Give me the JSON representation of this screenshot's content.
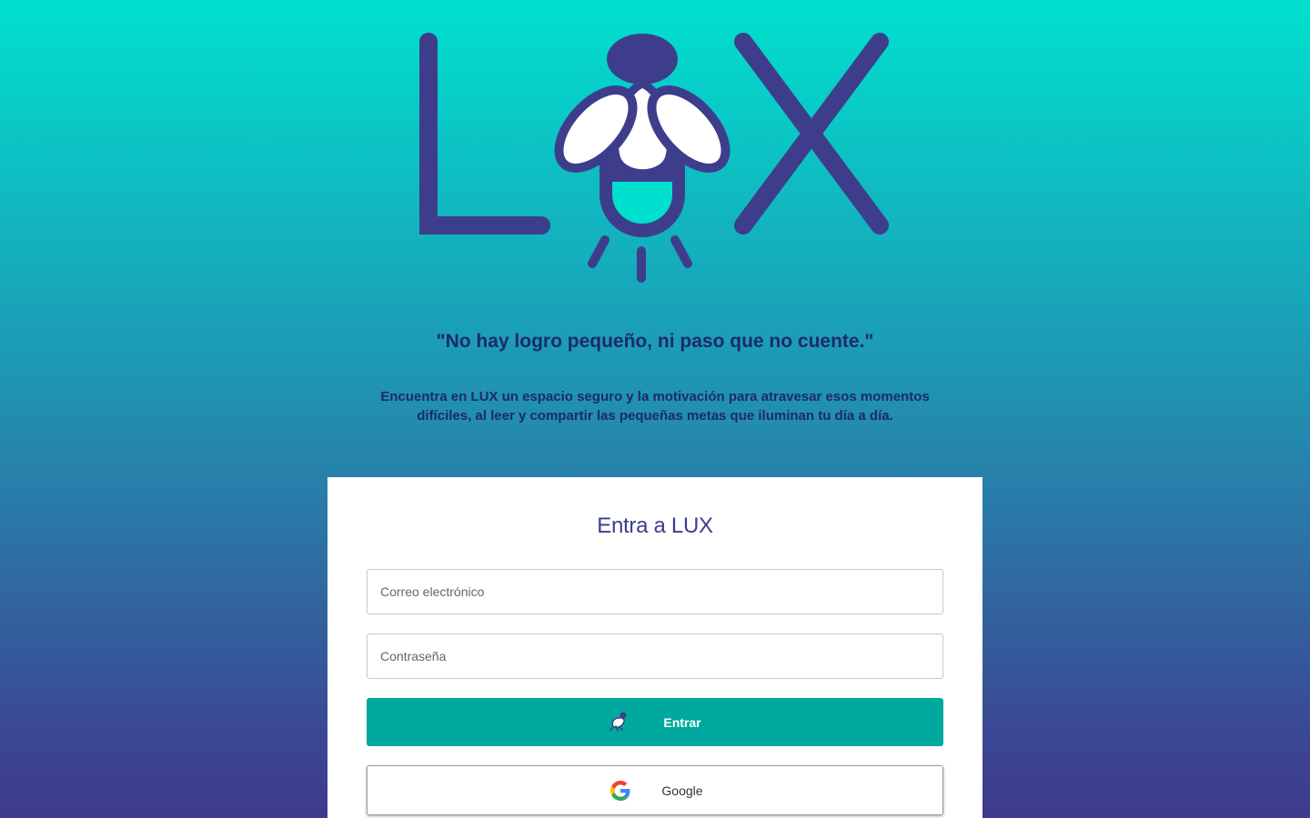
{
  "brand": {
    "logo_text": "LUX",
    "logo_icon": "firefly-icon",
    "colors": {
      "primary": "#3e3d8c",
      "accent": "#00e0cf",
      "button": "#00a99d"
    }
  },
  "hero": {
    "quote": "\"No hay logro pequeño, ni paso que no cuente.\"",
    "description": "Encuentra en LUX un espacio seguro y la motivación para atravesar esos momentos difíciles, al leer y compartir las pequeñas metas que iluminan tu día a día."
  },
  "login": {
    "title": "Entra a LUX",
    "email_placeholder": "Correo electrónico",
    "password_placeholder": "Contraseña",
    "submit_label": "Entrar",
    "submit_icon": "firefly-icon",
    "google_label": "Google",
    "google_icon": "google-icon"
  }
}
